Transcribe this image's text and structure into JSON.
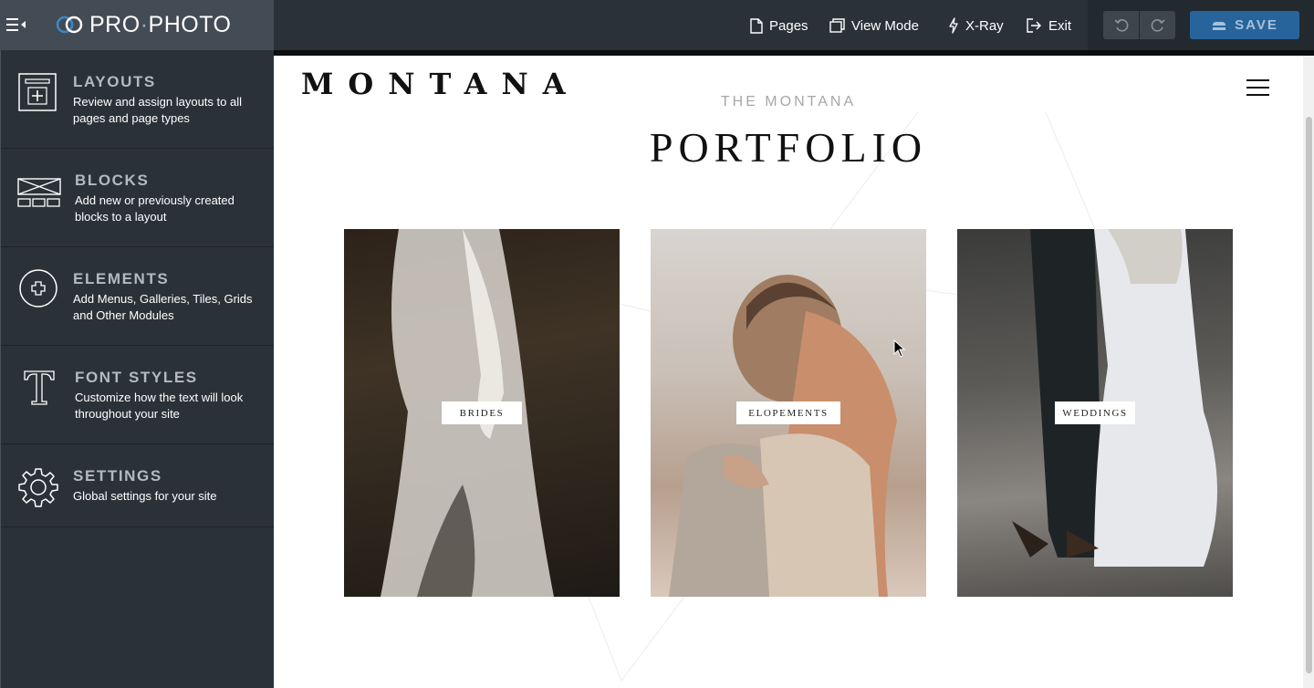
{
  "app": {
    "brand_text_1": "PRO",
    "brand_dot": "·",
    "brand_text_2": "PHOTO"
  },
  "topnav": {
    "pages": "Pages",
    "view_mode": "View Mode",
    "xray": "X-Ray",
    "exit": "Exit",
    "save": "SAVE"
  },
  "sidebar": {
    "items": [
      {
        "title": "LAYOUTS",
        "desc": "Review and assign layouts to all pages and page types",
        "icon": "layout-add-icon"
      },
      {
        "title": "BLOCKS",
        "desc": "Add new or previously created blocks to a layout",
        "icon": "blocks-icon"
      },
      {
        "title": "ELEMENTS",
        "desc": "Add Menus, Galleries, Tiles, Grids and Other Modules",
        "icon": "plus-circle-icon"
      },
      {
        "title": "FONT STYLES",
        "desc": "Customize how the text will look throughout your site",
        "icon": "font-icon"
      },
      {
        "title": "SETTINGS",
        "desc": "Global settings for your site",
        "icon": "gear-icon"
      }
    ]
  },
  "site": {
    "logo": "MONTANA",
    "subtitle": "THE MONTANA",
    "heading": "PORTFOLIO",
    "tiles": [
      {
        "label": "BRIDES"
      },
      {
        "label": "ELOPEMENTS"
      },
      {
        "label": "WEDDINGS"
      }
    ]
  },
  "colors": {
    "topbar_bg": "#2b3237",
    "brand_bg": "#434b55",
    "save_bg": "#28649c",
    "sidebar_title": "#b3bac0"
  }
}
